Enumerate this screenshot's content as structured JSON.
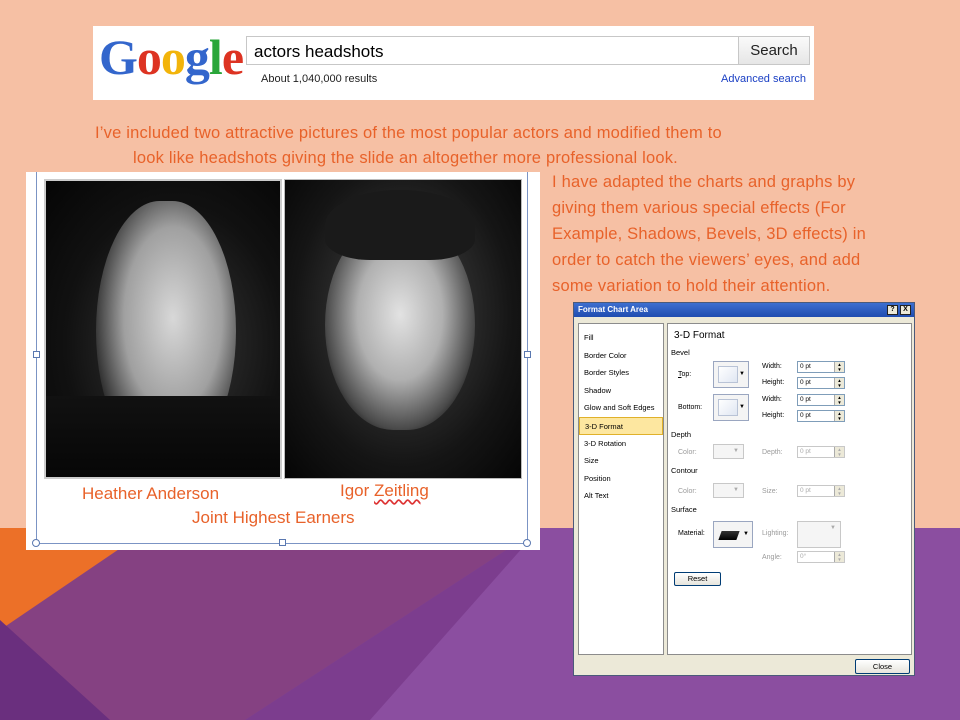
{
  "theme": {
    "background": "#f6c0a4",
    "accent_text": "#e8622a",
    "shape_orange": "#ec7028",
    "shape_purple": "#8b4ea0",
    "shape_dark_purple": "#7a3c8c"
  },
  "google": {
    "logo": "Google",
    "search_value": "actors headshots",
    "search_button": "Search",
    "results_count": "About 1,040,000 results",
    "advanced_link": "Advanced search"
  },
  "caption_top": {
    "line1": "I’ve included two attractive pictures of the most popular actors and modified them to",
    "line2": "look like headshots giving the slide an altogether more professional look."
  },
  "caption_right": {
    "line1": "I have adapted the charts and graphs by",
    "line2": "giving them various special effects (For",
    "line3": "Example, Shadows, Bevels, 3D effects) in",
    "line4": "order to catch the viewers’ eyes, and add",
    "line5": "some variation to hold their attention."
  },
  "photos": {
    "name1": "Heather Anderson",
    "name2_first": "Igor",
    "name2_last": "Zeitling",
    "subtitle": "Joint Highest Earners"
  },
  "dialog": {
    "title": "Format Chart Area",
    "help_btn": "?",
    "close_x": "X",
    "nav": [
      "Fill",
      "Border Color",
      "Border Styles",
      "Shadow",
      "Glow and Soft Edges",
      "3-D Format",
      "3-D Rotation",
      "Size",
      "Position",
      "Alt Text"
    ],
    "selected_nav": "3-D Format",
    "content_title": "3-D Format",
    "bevel": {
      "section": "Bevel",
      "top_label": "Top:",
      "bottom_label": "Bottom:",
      "width_label": "Width:",
      "height_label": "Height:",
      "top_width": "0 pt",
      "top_height": "0 pt",
      "bottom_width": "0 pt",
      "bottom_height": "0 pt"
    },
    "depth": {
      "section": "Depth",
      "color_label": "Color:",
      "depth_label": "Depth:",
      "depth_value": "0 pt"
    },
    "contour": {
      "section": "Contour",
      "color_label": "Color:",
      "size_label": "Size:",
      "size_value": "0 pt"
    },
    "surface": {
      "section": "Surface",
      "material_label": "Material:",
      "lighting_label": "Lighting:",
      "angle_label": "Angle:",
      "angle_value": "0°"
    },
    "reset_btn": "Reset",
    "close_btn": "Close"
  }
}
